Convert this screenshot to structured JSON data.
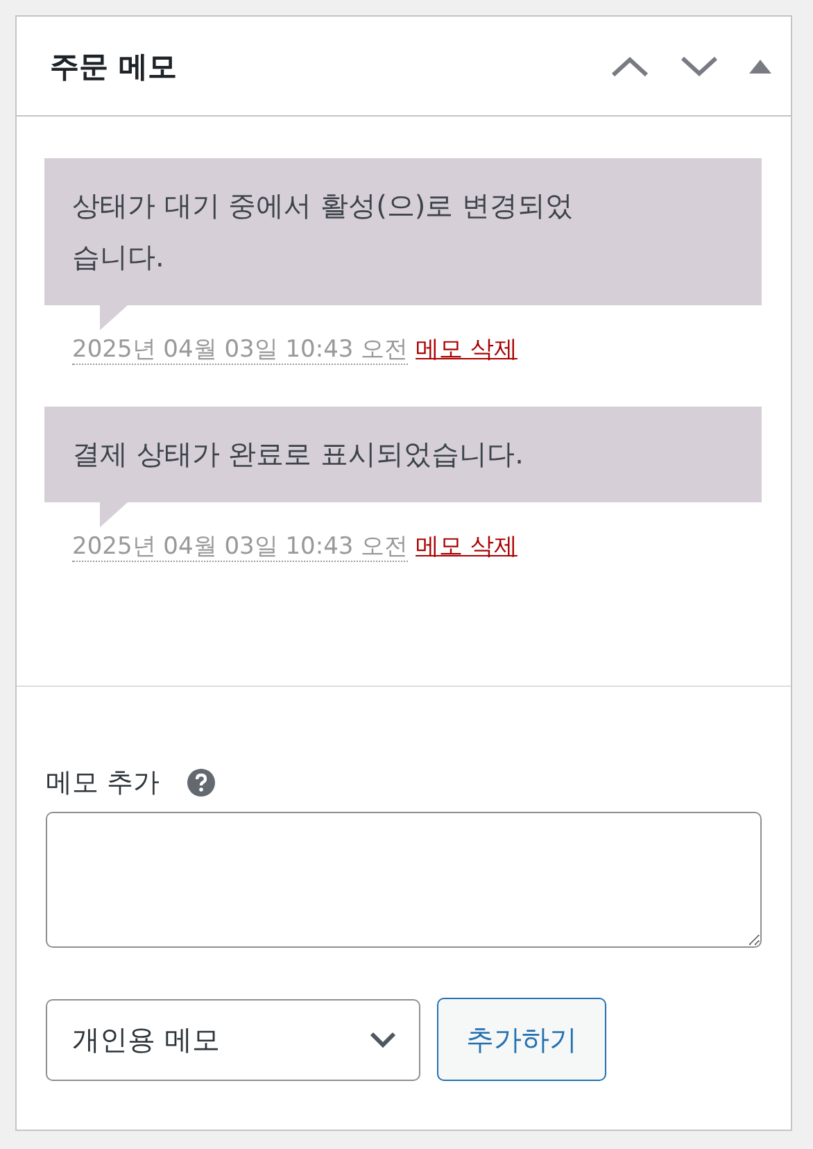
{
  "panel": {
    "title": "주문 메모",
    "collapsed": false
  },
  "notes": [
    {
      "text": "상태가 대기 중에서 활성(으)로 변경되었습니다.",
      "date": "2025년 04월 03일 10:43 오전",
      "delete": "메모 삭제"
    },
    {
      "text": "결제 상태가 완료로 표시되었습니다.",
      "date": "2025년 04월 03일 10:43 오전",
      "delete": "메모 삭제"
    }
  ],
  "add_note": {
    "label": "메모 추가",
    "note_type": "개인용 메모",
    "button": "추가하기"
  }
}
